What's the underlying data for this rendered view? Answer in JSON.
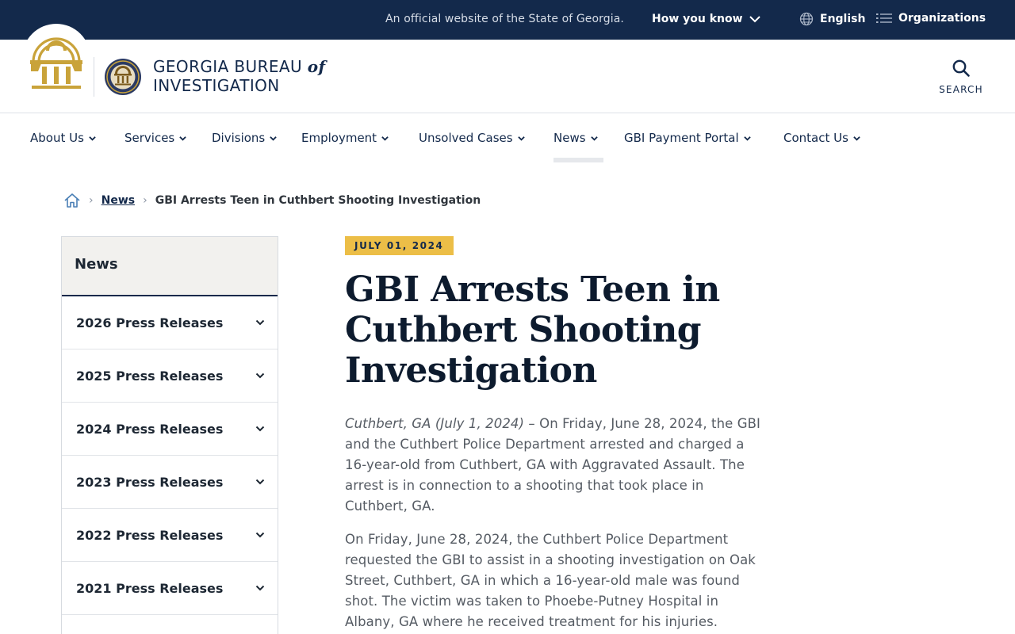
{
  "banner": {
    "official_text": "An official website of the State of Georgia.",
    "how_you_know": "How you know",
    "language": "English",
    "organizations": "Organizations"
  },
  "header": {
    "title_line1": "GEORGIA BUREAU",
    "title_of": "of",
    "title_line2": "INVESTIGATION",
    "search_label": "SEARCH"
  },
  "nav": {
    "items": [
      {
        "label": "About Us"
      },
      {
        "label": "Services"
      },
      {
        "label": "Divisions"
      },
      {
        "label": "Employment"
      },
      {
        "label": "Unsolved Cases"
      },
      {
        "label": "News"
      },
      {
        "label": "GBI Payment Portal"
      },
      {
        "label": "Contact Us"
      }
    ],
    "active": "News"
  },
  "breadcrumb": {
    "parent": "News",
    "current": "GBI Arrests Teen in Cuthbert Shooting Investigation"
  },
  "sidebar": {
    "heading": "News",
    "items": [
      {
        "label": "2026 Press Releases"
      },
      {
        "label": "2025 Press Releases"
      },
      {
        "label": "2024 Press Releases"
      },
      {
        "label": "2023 Press Releases"
      },
      {
        "label": "2022 Press Releases"
      },
      {
        "label": "2021 Press Releases"
      }
    ]
  },
  "article": {
    "date": "JULY 01, 2024",
    "title": "GBI Arrests Teen in Cuthbert Shooting Investigation",
    "dateline": "Cuthbert, GA (July 1, 2024)",
    "para1_rest": " – On Friday, June 28, 2024, the GBI and the Cuthbert Police Department arrested and charged a 16-year-old from Cuthbert, GA with Aggravated Assault. The arrest is in connection to a shooting that took place in Cuthbert, GA.",
    "para2": "On Friday, June 28, 2024, the Cuthbert Police Department requested the GBI to assist in a shooting investigation on Oak Street, Cuthbert, GA in which a 16-year-old male was found shot. The victim was taken to Phoebe-Putney Hospital in Albany, GA where he received treatment for his injuries."
  },
  "colors": {
    "banner_bg": "#13294b",
    "badge_bg": "#ecbe47",
    "seal_gold": "#c9a33a"
  }
}
